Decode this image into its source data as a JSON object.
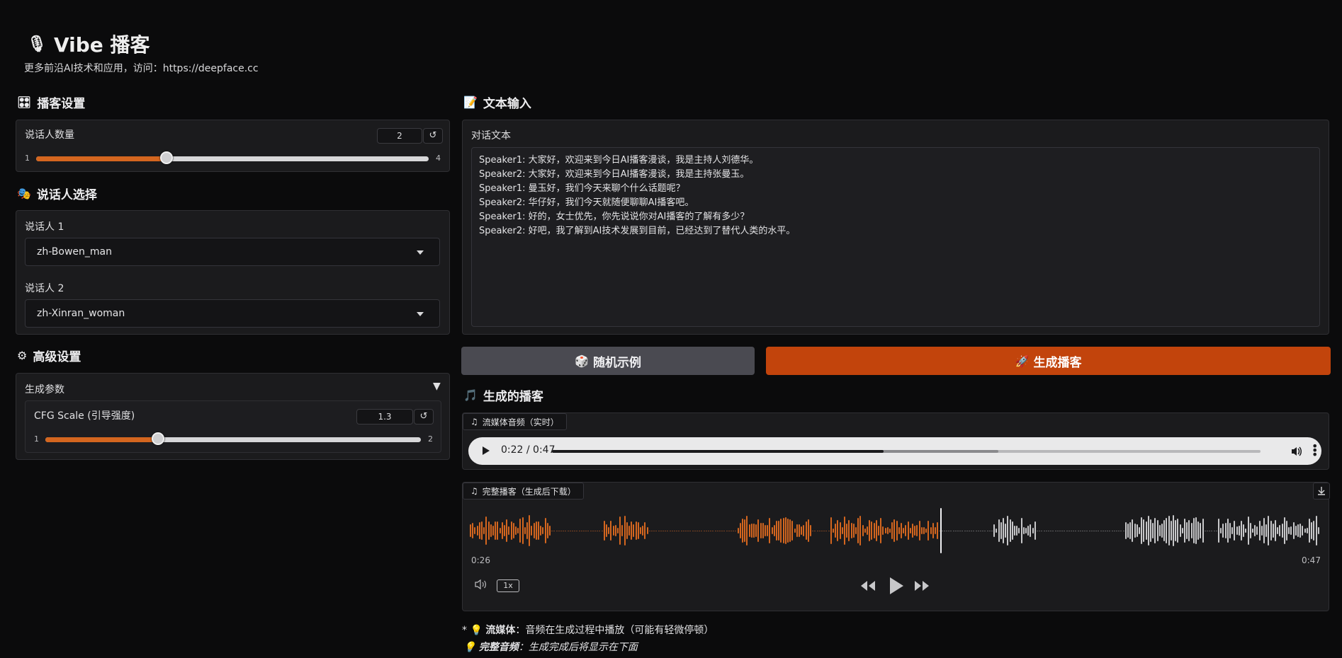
{
  "app": {
    "title": "Vibe 播客",
    "subtitle": "更多前沿AI技术和应用，访问：https://deepface.cc"
  },
  "settings": {
    "header": "播客设置",
    "speaker_count": {
      "label": "说话人数量",
      "value": "2",
      "min": "1",
      "max": "4",
      "fraction": 0.333
    }
  },
  "speakers": {
    "header": "说话人选择",
    "items": [
      {
        "label": "说话人 1",
        "value": "zh-Bowen_man"
      },
      {
        "label": "说话人 2",
        "value": "zh-Xinran_woman"
      }
    ]
  },
  "advanced": {
    "header": "高级设置",
    "accordion_label": "生成参数",
    "cfg": {
      "label": "CFG Scale (引导强度)",
      "value": "1.3",
      "min": "1",
      "max": "2",
      "fraction": 0.3
    }
  },
  "text_input": {
    "header": "文本输入",
    "label": "对话文本",
    "value": "Speaker1: 大家好，欢迎来到今日AI播客漫谈，我是主持人刘德华。\nSpeaker2: 大家好，欢迎来到今日AI播客漫谈，我是主持张曼玉。\nSpeaker1: 曼玉好，我们今天来聊个什么话题呢？\nSpeaker2: 华仔好，我们今天就随便聊聊AI播客吧。\nSpeaker1: 好的，女士优先，你先说说你对AI播客的了解有多少？\nSpeaker2: 好吧，我了解到AI技术发展到目前，已经达到了替代人类的水平。"
  },
  "buttons": {
    "random_example": "随机示例",
    "generate": "生成播客"
  },
  "output": {
    "header": "生成的播客",
    "streaming": {
      "tag": "流媒体音频（实时）",
      "time": "0:22 / 0:47",
      "progress": 0.468,
      "buffered": 0.63
    },
    "complete": {
      "tag": "完整播客（生成后下载）",
      "current_time": "0:26",
      "total_time": "0:47",
      "progress": 0.553,
      "speed": "1x"
    }
  },
  "footer": {
    "line1_prefix": "*",
    "line1_bold": "流媒体",
    "line1_text": "：音频在生成过程中播放（可能有轻微停顿）",
    "line2_bold": "完整音频",
    "line2_text": "：生成完成后将显示在下面"
  },
  "colors": {
    "accent": "#c2440c",
    "slider": "#d4661f",
    "wave_played": "#d4661f",
    "wave_rest": "#c8c8ca"
  },
  "icons": [
    "microphone-icon",
    "control-panel-icon",
    "speaker-masks-icon",
    "gear-icon",
    "memo-icon",
    "die-icon",
    "rocket-icon",
    "music-note-icon",
    "play-icon",
    "volume-icon",
    "more-icon",
    "download-icon",
    "rewind-icon",
    "forward-icon",
    "bulb-icon"
  ]
}
